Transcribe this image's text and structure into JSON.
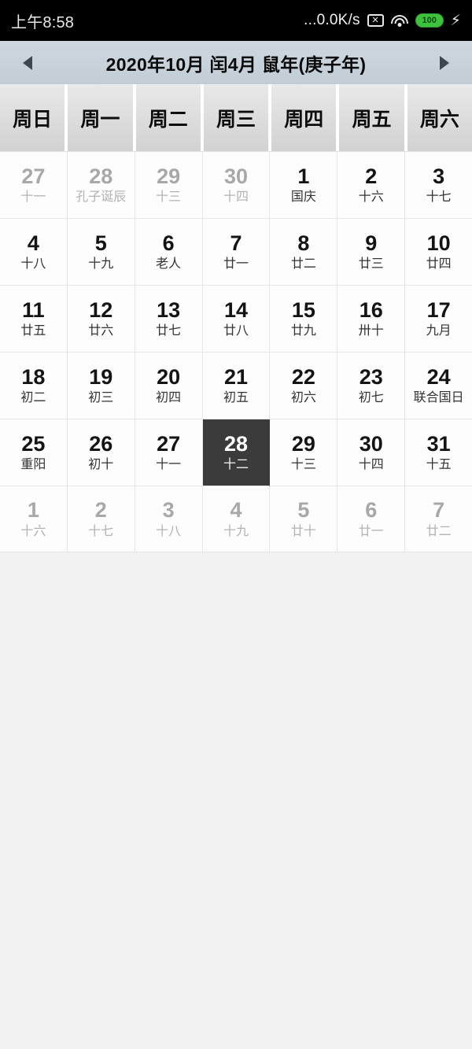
{
  "statusbar": {
    "time": "上午8:58",
    "net_speed": "...0.0K/s",
    "x_icon_glyph": "✕",
    "battery_level": "100",
    "charging_glyph": "⚡",
    "icons": [
      "x-box-icon",
      "wifi-icon",
      "battery-icon",
      "charging-bolt-icon"
    ]
  },
  "titlebar": {
    "prev_label": "◀",
    "next_label": "▶",
    "title": "2020年10月 闰4月 鼠年(庚子年)"
  },
  "weekdays": [
    "周日",
    "周一",
    "周二",
    "周三",
    "周四",
    "周五",
    "周六"
  ],
  "colors": {
    "selected_bg": "#3b3b3b",
    "titlebar_bg": "#c9d3db",
    "statusbar_bg": "#000000",
    "page_bg": "#f2f2f2",
    "battery_green": "#3ec23e"
  },
  "selected_date": "28",
  "weeks": [
    [
      {
        "day": "27",
        "lunar": "十一",
        "out": true
      },
      {
        "day": "28",
        "lunar": "孔子诞辰",
        "out": true
      },
      {
        "day": "29",
        "lunar": "十三",
        "out": true
      },
      {
        "day": "30",
        "lunar": "十四",
        "out": true
      },
      {
        "day": "1",
        "lunar": "国庆",
        "out": false
      },
      {
        "day": "2",
        "lunar": "十六",
        "out": false
      },
      {
        "day": "3",
        "lunar": "十七",
        "out": false
      }
    ],
    [
      {
        "day": "4",
        "lunar": "十八",
        "out": false
      },
      {
        "day": "5",
        "lunar": "十九",
        "out": false
      },
      {
        "day": "6",
        "lunar": "老人",
        "out": false
      },
      {
        "day": "7",
        "lunar": "廿一",
        "out": false
      },
      {
        "day": "8",
        "lunar": "廿二",
        "out": false
      },
      {
        "day": "9",
        "lunar": "廿三",
        "out": false
      },
      {
        "day": "10",
        "lunar": "廿四",
        "out": false
      }
    ],
    [
      {
        "day": "11",
        "lunar": "廿五",
        "out": false
      },
      {
        "day": "12",
        "lunar": "廿六",
        "out": false
      },
      {
        "day": "13",
        "lunar": "廿七",
        "out": false
      },
      {
        "day": "14",
        "lunar": "廿八",
        "out": false
      },
      {
        "day": "15",
        "lunar": "廿九",
        "out": false
      },
      {
        "day": "16",
        "lunar": "卅十",
        "out": false
      },
      {
        "day": "17",
        "lunar": "九月",
        "out": false
      }
    ],
    [
      {
        "day": "18",
        "lunar": "初二",
        "out": false
      },
      {
        "day": "19",
        "lunar": "初三",
        "out": false
      },
      {
        "day": "20",
        "lunar": "初四",
        "out": false
      },
      {
        "day": "21",
        "lunar": "初五",
        "out": false
      },
      {
        "day": "22",
        "lunar": "初六",
        "out": false
      },
      {
        "day": "23",
        "lunar": "初七",
        "out": false
      },
      {
        "day": "24",
        "lunar": "联合国日",
        "out": false
      }
    ],
    [
      {
        "day": "25",
        "lunar": "重阳",
        "out": false
      },
      {
        "day": "26",
        "lunar": "初十",
        "out": false
      },
      {
        "day": "27",
        "lunar": "十一",
        "out": false
      },
      {
        "day": "28",
        "lunar": "十二",
        "out": false,
        "selected": true
      },
      {
        "day": "29",
        "lunar": "十三",
        "out": false
      },
      {
        "day": "30",
        "lunar": "十四",
        "out": false
      },
      {
        "day": "31",
        "lunar": "十五",
        "out": false
      }
    ],
    [
      {
        "day": "1",
        "lunar": "十六",
        "out": true
      },
      {
        "day": "2",
        "lunar": "十七",
        "out": true
      },
      {
        "day": "3",
        "lunar": "十八",
        "out": true
      },
      {
        "day": "4",
        "lunar": "十九",
        "out": true
      },
      {
        "day": "5",
        "lunar": "廿十",
        "out": true
      },
      {
        "day": "6",
        "lunar": "廿一",
        "out": true
      },
      {
        "day": "7",
        "lunar": "廿二",
        "out": true
      }
    ]
  ]
}
